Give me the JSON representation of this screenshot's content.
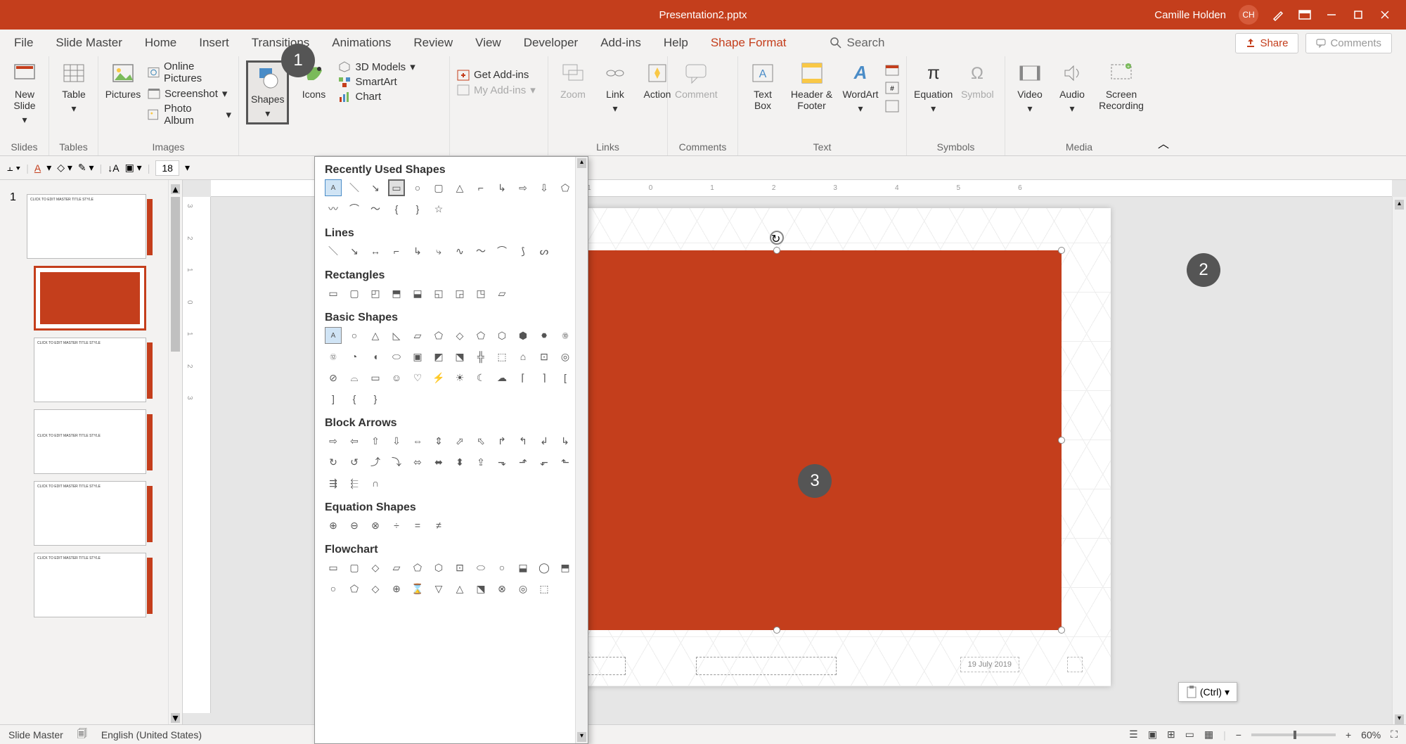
{
  "app": {
    "title": "Presentation2.pptx",
    "user_name": "Camille Holden",
    "user_initials": "CH"
  },
  "tabs": {
    "file": "File",
    "slidemaster": "Slide Master",
    "home": "Home",
    "insert": "Insert",
    "transitions": "Transitions",
    "animations": "Animations",
    "review": "Review",
    "view": "View",
    "developer": "Developer",
    "addins": "Add-ins",
    "help": "Help",
    "shapeformat": "Shape Format",
    "search": "Search",
    "share": "Share",
    "comments": "Comments"
  },
  "ribbon_groups": {
    "slides": {
      "label": "Slides",
      "new_slide": "New Slide"
    },
    "tables": {
      "label": "Tables",
      "table": "Table"
    },
    "images": {
      "label": "Images",
      "pictures": "Pictures",
      "online_pictures": "Online Pictures",
      "screenshot": "Screenshot",
      "photo_album": "Photo Album"
    },
    "illustrations": {
      "shapes": "Shapes",
      "icons": "Icons",
      "models": "3D Models",
      "smartart": "SmartArt",
      "chart": "Chart"
    },
    "addins_grp": {
      "get": "Get Add-ins",
      "my": "My Add-ins"
    },
    "links": {
      "label": "Links",
      "zoom": "Zoom",
      "link": "Link",
      "action": "Action"
    },
    "comments": {
      "label": "Comments",
      "comment": "Comment"
    },
    "text": {
      "label": "Text",
      "textbox": "Text Box",
      "header": "Header & Footer",
      "wordart": "WordArt"
    },
    "symbols": {
      "label": "Symbols",
      "equation": "Equation",
      "symbol": "Symbol"
    },
    "media": {
      "label": "Media",
      "video": "Video",
      "audio": "Audio",
      "screen_rec": "Screen Recording"
    }
  },
  "font_size": "18",
  "shapes_gallery": {
    "recent": "Recently Used Shapes",
    "lines": "Lines",
    "rectangles": "Rectangles",
    "basic": "Basic Shapes",
    "block_arrows": "Block Arrows",
    "equation": "Equation Shapes",
    "flowchart": "Flowchart"
  },
  "callouts": {
    "c1": "1",
    "c2": "2",
    "c3": "3"
  },
  "slide_date": "19 July 2019",
  "paste_popup": "(Ctrl)",
  "status": {
    "mode": "Slide Master",
    "lang": "English (United States)",
    "zoom": "60%"
  }
}
